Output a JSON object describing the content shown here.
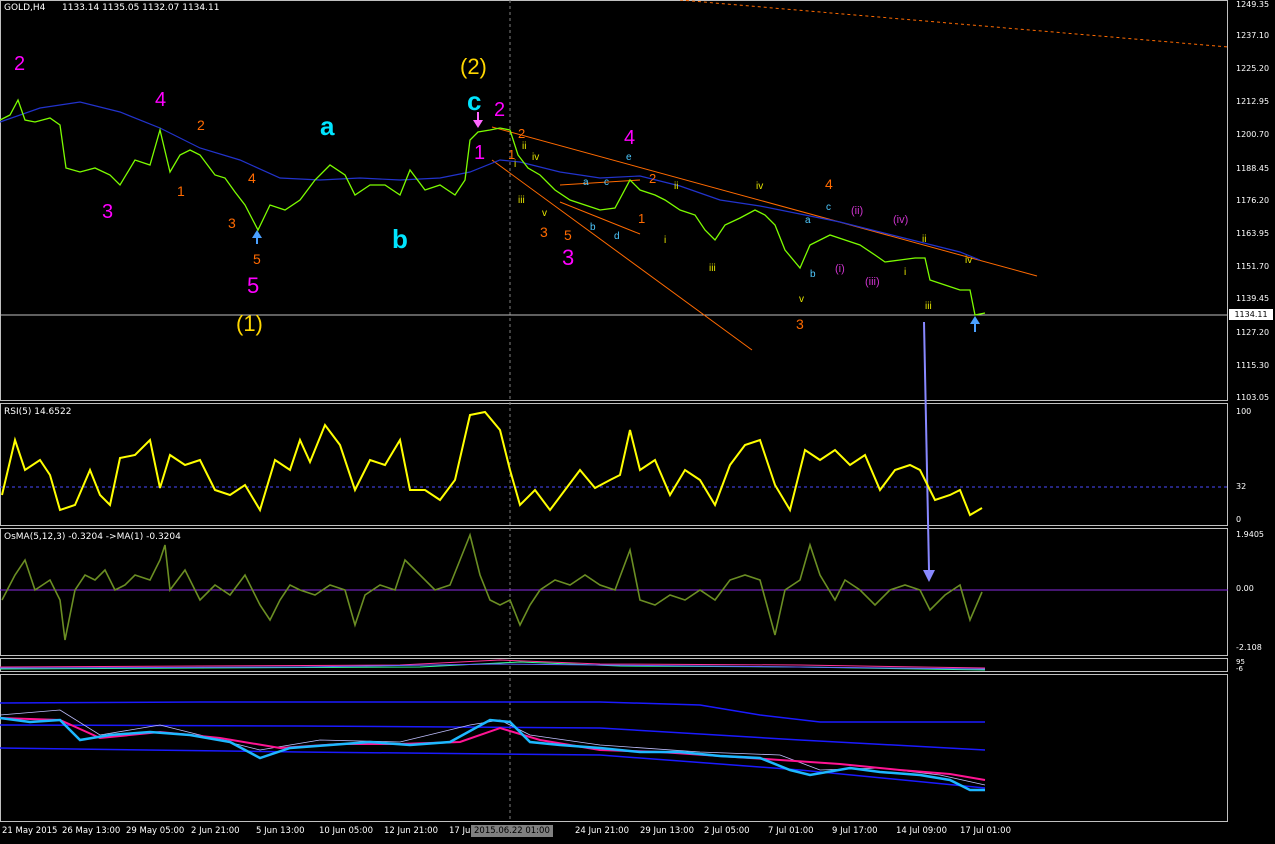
{
  "header": {
    "symbol_label": "GOLD,H4",
    "ohlc": "1133.14 1135.05 1132.07 1134.11"
  },
  "price_axis": [
    "1249.35",
    "1237.10",
    "1225.20",
    "1212.95",
    "1200.70",
    "1188.45",
    "1176.20",
    "1163.95",
    "1151.70",
    "1139.45",
    "1127.20",
    "1115.30",
    "1103.05"
  ],
  "current_price": "1134.11",
  "rsi": {
    "label": "RSI(5) 14.6522",
    "ticks": [
      "100",
      "32",
      "0"
    ]
  },
  "osma": {
    "label": "OsMA(5,12,3) -0.3204  ->MA(1) -0.3204",
    "ticks": [
      "1.9405",
      "0.00",
      "-2.108"
    ]
  },
  "stoch": {
    "ticks": [
      "95",
      "-6"
    ]
  },
  "time_axis": [
    "21 May 2015",
    "26 May 13:00",
    "29 May 05:00",
    "2 Jun 21:00",
    "5 Jun 13:00",
    "10 Jun 05:00",
    "12 Jun 21:00",
    "17 Jul",
    "24 Jun 21:00",
    "29 Jun 13:00",
    "2 Jul 05:00",
    "7 Jul 01:00",
    "9 Jul 17:00",
    "14 Jul 09:00",
    "17 Jul 01:00"
  ],
  "crosshair_date": "2015.06.22 01:00",
  "colors": {
    "price": "#7cfc00",
    "ma": "#2233cc",
    "rsi": "#ffff00",
    "osma": "#6b8e23",
    "magenta": "#ff00ff",
    "cyan": "#00e5ff",
    "orange": "#ff6a00",
    "yellow": "#ffd700"
  },
  "wave_labels": {
    "w2_left": "2",
    "w4_left": "4",
    "w3_left": "3",
    "w5_left": "5",
    "deg1": "(1)",
    "sub2": "2",
    "sub1": "1",
    "sub4": "4",
    "sub3": "3",
    "sub5": "5",
    "a": "a",
    "b": "b",
    "c": "c",
    "deg2": "(2)",
    "m2": "2",
    "m1": "1",
    "o2": "2",
    "o1": "1",
    "r_i": "i",
    "r_ii": "ii",
    "r_iii": "iii",
    "r_iv": "iv",
    "r_v": "v",
    "o3": "3",
    "o5": "5",
    "m3": "3",
    "s_a": "a",
    "s_b": "b",
    "s_c": "c",
    "s_d": "d",
    "s_e": "e",
    "m4": "4",
    "o2b": "2",
    "o1b": "1",
    "r_i2": "i",
    "r_ii2": "ii",
    "r_iii2": "iii",
    "r_iv2": "iv",
    "r_v2": "v",
    "o3b": "3",
    "o4b": "4",
    "s_a2": "a",
    "s_b2": "b",
    "s_c2": "c",
    "p_i": "(i)",
    "p_ii": "(ii)",
    "p_iii": "(iii)",
    "p_iv": "(iv)",
    "r_i3": "i",
    "r_ii3": "ii",
    "r_iii3": "iii",
    "r_iv3": "iv"
  }
}
